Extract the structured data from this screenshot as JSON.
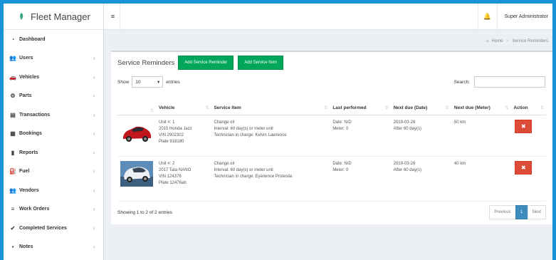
{
  "app": {
    "title": "Fleet Manager"
  },
  "topbar": {
    "user": "Super Administrator"
  },
  "breadcrumb": {
    "home": "Home",
    "current": "Service Reminders"
  },
  "sidebar": {
    "items": [
      {
        "label": "Dashboard",
        "icon": "dashboard-icon",
        "glyph": "◔",
        "chevron": false
      },
      {
        "label": "Users",
        "icon": "users-icon",
        "glyph": "👥",
        "chevron": true
      },
      {
        "label": "Vehicles",
        "icon": "car-icon",
        "glyph": "🚗",
        "chevron": true
      },
      {
        "label": "Parts",
        "icon": "parts-icon",
        "glyph": "⚙",
        "chevron": true
      },
      {
        "label": "Transactions",
        "icon": "transactions-icon",
        "glyph": "▤",
        "chevron": true
      },
      {
        "label": "Bookings",
        "icon": "bookings-icon",
        "glyph": "▦",
        "chevron": true
      },
      {
        "label": "Reports",
        "icon": "reports-icon",
        "glyph": "▮",
        "chevron": true
      },
      {
        "label": "Fuel",
        "icon": "fuel-icon",
        "glyph": "⛽",
        "chevron": true
      },
      {
        "label": "Vendors",
        "icon": "vendors-icon",
        "glyph": "👥",
        "chevron": true
      },
      {
        "label": "Work Orders",
        "icon": "work-orders-icon",
        "glyph": "≡",
        "chevron": true
      },
      {
        "label": "Completed Services",
        "icon": "check-icon",
        "glyph": "✔",
        "chevron": true
      },
      {
        "label": "Notes",
        "icon": "notes-icon",
        "glyph": "▪",
        "chevron": true
      }
    ]
  },
  "box": {
    "title": "Service Reminders",
    "add_reminder_label": "Add Service Reminder",
    "add_item_label": "Add Service Item"
  },
  "controls": {
    "show_label": "Show",
    "entries_value": "10",
    "entries_label": "entries",
    "search_label": "Search:"
  },
  "table": {
    "headers": [
      "",
      "Vehicle",
      "Service Item",
      "Last performed",
      "Next due (Date)",
      "Next due (Meter)",
      "Action"
    ],
    "rows": [
      {
        "image": "red-car",
        "vehicle": [
          "Unit #: 1",
          "2015 Honda Jazz",
          "VIN 2902302",
          "Plate 918180"
        ],
        "service": [
          "Change oil",
          "Interval: 60 day(s) or meter unit",
          "Technician in charge: Kelvin Lawrence"
        ],
        "last": [
          "Date: N/D",
          "Meter: 0"
        ],
        "next_date": [
          "2019-03-28",
          "After 60 day(s)"
        ],
        "next_meter": "50 km"
      },
      {
        "image": "white-car",
        "vehicle": [
          "Unit #: 2",
          "2017 Tata NANO",
          "VIN 124376",
          "Plate 12476ab"
        ],
        "service": [
          "Change oil",
          "Interval: 60 day(s) or meter unit",
          "Technician in charge: Eyerience Protesila"
        ],
        "last": [
          "Date: N/D",
          "Meter: 0"
        ],
        "next_date": [
          "2019-03-28",
          "After 60 day(s)"
        ],
        "next_meter": "40 km"
      }
    ]
  },
  "footer": {
    "showing": "Showing 1 to 2 of 2 entries",
    "previous": "Previous",
    "page": "1",
    "next": "Next"
  },
  "colors": {
    "frame": "#1a93d6",
    "green": "#00a65a",
    "red": "#dd4b39",
    "blue": "#3c8dbc"
  }
}
